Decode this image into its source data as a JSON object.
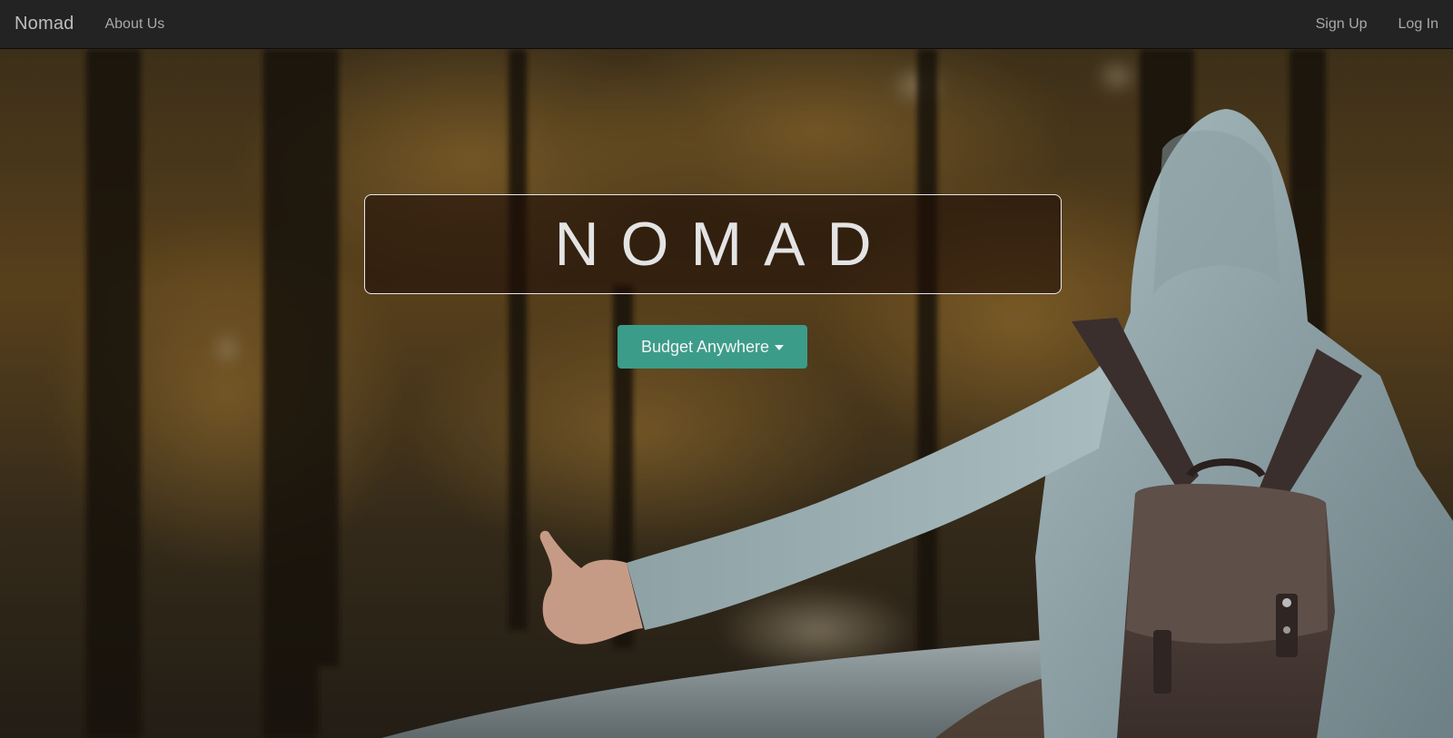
{
  "navbar": {
    "brand": "Nomad",
    "about_label": "About Us",
    "signup_label": "Sign Up",
    "login_label": "Log In"
  },
  "hero": {
    "title": "NOMAD",
    "button_label": "Budget Anywhere",
    "button_icon": "caret-down-icon",
    "background_image": "hitchhiker-in-autumn-forest"
  },
  "colors": {
    "navbar_bg": "#232323",
    "button_teal": "#3c9c8a",
    "title_text": "#e4e4e4"
  }
}
